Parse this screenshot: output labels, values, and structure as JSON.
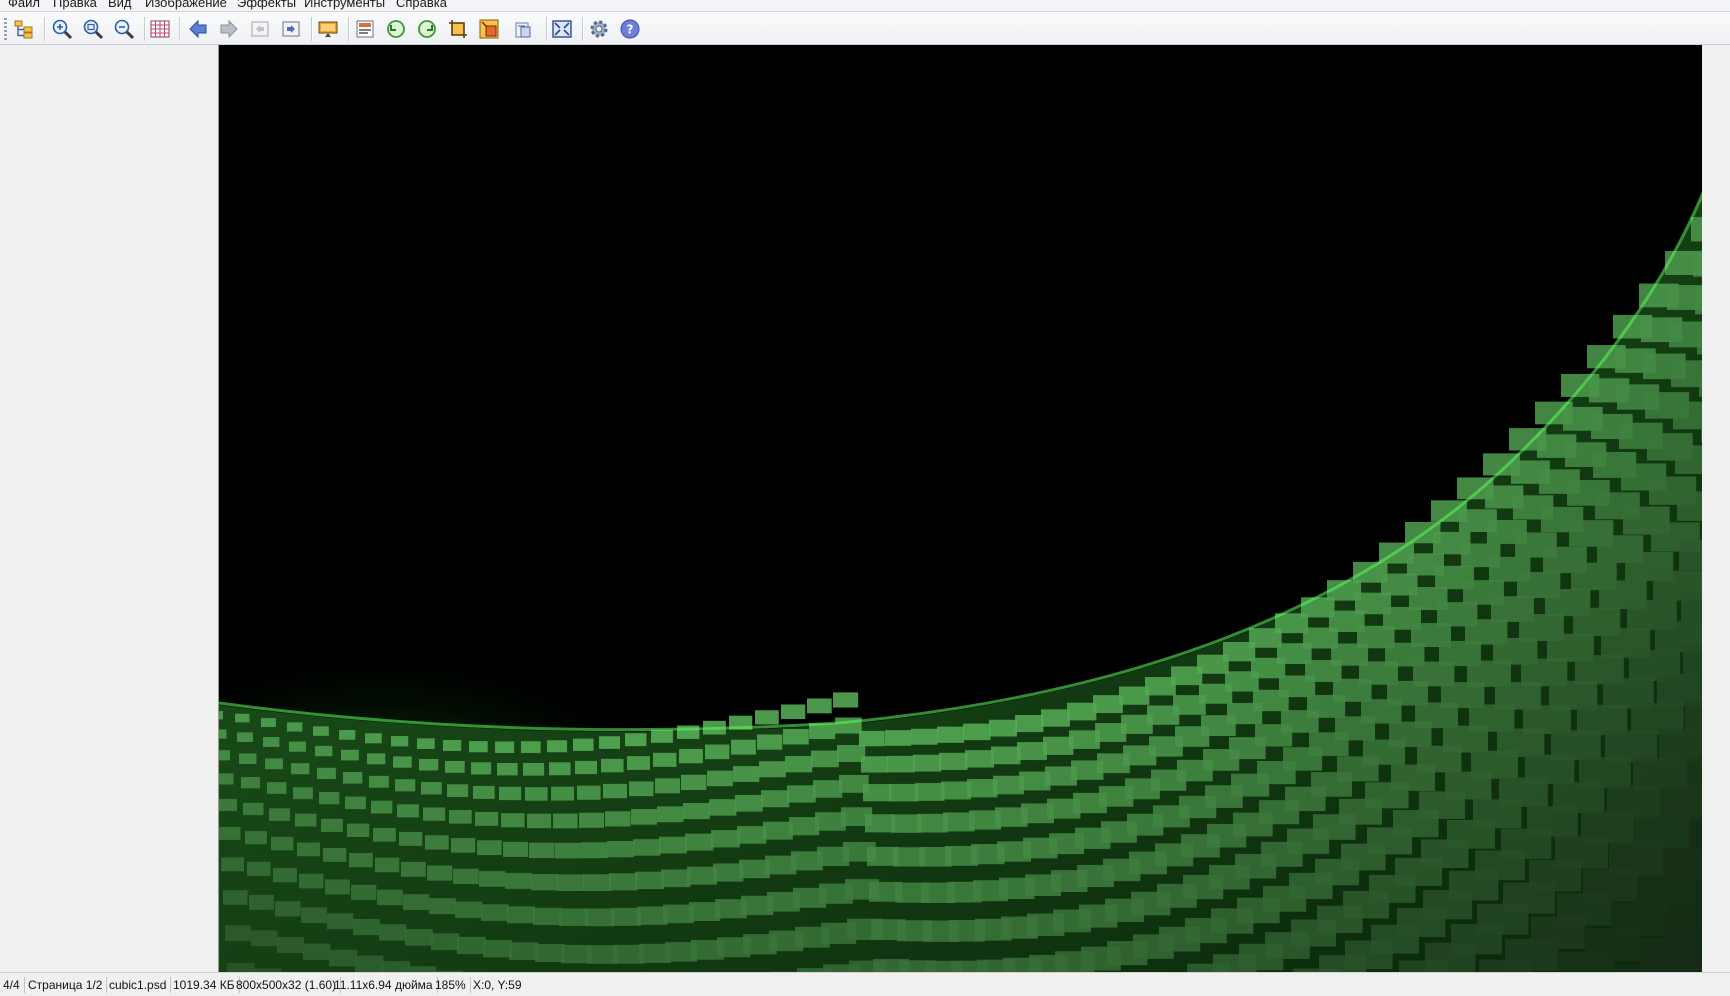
{
  "menu": {
    "items": [
      "Файл",
      "Правка",
      "Вид",
      "Изображение",
      "Эффекты",
      "Инструменты",
      "Справка"
    ]
  },
  "toolbar": {
    "buttons": [
      {
        "name": "browser-icon"
      },
      {
        "name": "zoom-in-icon"
      },
      {
        "name": "zoom-fit-icon"
      },
      {
        "name": "zoom-out-icon"
      },
      {
        "name": "grid-icon"
      },
      {
        "name": "back-arrow-icon"
      },
      {
        "name": "forward-arrow-icon"
      },
      {
        "name": "prev-page-icon"
      },
      {
        "name": "next-page-icon"
      },
      {
        "name": "slideshow-icon"
      },
      {
        "name": "image-info-icon"
      },
      {
        "name": "rotate-left-icon"
      },
      {
        "name": "rotate-right-icon"
      },
      {
        "name": "crop-icon"
      },
      {
        "name": "resize-icon"
      },
      {
        "name": "scan-icon"
      },
      {
        "name": "fullscreen-icon"
      },
      {
        "name": "settings-gear-icon"
      },
      {
        "name": "help-icon"
      }
    ]
  },
  "statusbar": {
    "file_index": "4/4",
    "page": "Страница 1/2",
    "filename": "cubic1.psd",
    "filesize": "1019.34 КБ",
    "dimensions": "800x500x32 (1.60)",
    "print_size": "11.11x6.94 дюйма",
    "zoom": "185%",
    "cursor_pos": "X:0, Y:59"
  },
  "colors": {
    "accent_green": "#3fbf3f",
    "viewer_bg": "#000000"
  }
}
